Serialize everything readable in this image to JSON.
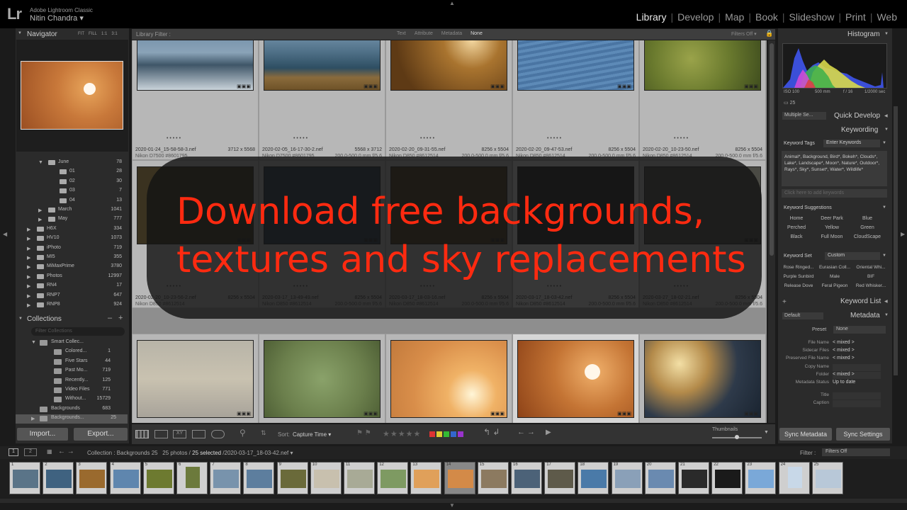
{
  "app": {
    "logo": "Lr",
    "name": "Adobe Lightroom Classic",
    "user": "Nitin Chandra ▾"
  },
  "modules": [
    "Library",
    "Develop",
    "Map",
    "Book",
    "Slideshow",
    "Print",
    "Web"
  ],
  "navigator": {
    "title": "Navigator",
    "zoom": [
      "FIT",
      "FILL",
      "1:1",
      "3:1"
    ]
  },
  "folders": [
    {
      "label": "June",
      "count": "78",
      "indent": 2
    },
    {
      "label": "01",
      "count": "28",
      "indent": 3
    },
    {
      "label": "02",
      "count": "30",
      "indent": 3
    },
    {
      "label": "03",
      "count": "7",
      "indent": 3
    },
    {
      "label": "04",
      "count": "13",
      "indent": 3
    },
    {
      "label": "March",
      "count": "1041",
      "indent": 2
    },
    {
      "label": "May",
      "count": "777",
      "indent": 2
    },
    {
      "label": "H6X",
      "count": "334",
      "indent": 1
    },
    {
      "label": "HV10",
      "count": "1073",
      "indent": 1
    },
    {
      "label": "iPhoto",
      "count": "719",
      "indent": 1
    },
    {
      "label": "MI5",
      "count": "355",
      "indent": 1
    },
    {
      "label": "MiMaxPrime",
      "count": "3780",
      "indent": 1
    },
    {
      "label": "Photos",
      "count": "12997",
      "indent": 1
    },
    {
      "label": "RN4",
      "count": "17",
      "indent": 1
    },
    {
      "label": "RNP7",
      "count": "647",
      "indent": 1
    },
    {
      "label": "RNP8",
      "count": "924",
      "indent": 1
    }
  ],
  "collections": {
    "title": "Collections",
    "filter_placeholder": "Filter Collections",
    "items": [
      {
        "label": "Smart Collec...",
        "count": ""
      },
      {
        "label": "Colored...",
        "count": "1"
      },
      {
        "label": "Five Stars",
        "count": "44"
      },
      {
        "label": "Past Mo...",
        "count": "719"
      },
      {
        "label": "Recently...",
        "count": "125"
      },
      {
        "label": "Video Files",
        "count": "771"
      },
      {
        "label": "Without...",
        "count": "15729"
      },
      {
        "label": "Backgrounds",
        "count": "683"
      },
      {
        "label": "Backgrounds...",
        "count": "25"
      }
    ]
  },
  "left_buttons": {
    "import": "Import...",
    "export": "Export..."
  },
  "library_filter": {
    "label": "Library Filter :",
    "tabs": [
      "Text",
      "Attribute",
      "Metadata",
      "None"
    ],
    "filters_off": "Filters Off ▾"
  },
  "grid": {
    "row1": [
      {
        "file": "2020-01-24_15-58-58-3.nef",
        "dims": "3712 x 5568",
        "cam": "Nikon D7500 #8601795",
        "lens": ""
      },
      {
        "file": "2020-02-05_16-17-30-2.nef",
        "dims": "5568 x 3712",
        "cam": "Nikon D7500 #8601795",
        "lens": "200.0-500.0 mm f/5.6"
      },
      {
        "file": "2020-02-20_09-31-55.nef",
        "dims": "8256 x 5504",
        "cam": "Nikon D850 #8612514",
        "lens": "200.0-500.0 mm f/5.6"
      },
      {
        "file": "2020-02-20_09-47-53.nef",
        "dims": "8256 x 5504",
        "cam": "Nikon D850 #8612514",
        "lens": "200.0-500.0 mm f/5.6"
      },
      {
        "file": "2020-02-20_10-23-50.nef",
        "dims": "8256 x 5504",
        "cam": "Nikon D850 #8612514",
        "lens": "200.0-500.0 mm f/5.6"
      }
    ],
    "row2": [
      {
        "file": "2020-02-20_10-23-56-2.nef",
        "dims": "8256 x 5504",
        "cam": "Nikon D850 #8612514",
        "lens": ""
      },
      {
        "file": "2020-03-17_13-49-49.nef",
        "dims": "8256 x 5504",
        "cam": "Nikon D850 #8612514",
        "lens": "200.0-500.0 mm f/5.6"
      },
      {
        "file": "2020-03-17_18-03-16.nef",
        "dims": "8256 x 5504",
        "cam": "Nikon D850 #8612514",
        "lens": "200.0-500.0 mm f/5.6"
      },
      {
        "file": "2020-03-17_18-03-42.nef",
        "dims": "8256 x 5504",
        "cam": "Nikon D850 #8612514",
        "lens": "200.0-500.0 mm f/5.6"
      },
      {
        "file": "2020-03-27_18-02-21.nef",
        "dims": "8256 x 5504",
        "cam": "Nikon D850 #8612514",
        "lens": "200.0-500.0 mm f/5.6"
      }
    ],
    "dots": "• • • • •"
  },
  "overlay_text": [
    "Download free backgrounds,",
    "textures and sky replacements"
  ],
  "toolbar": {
    "sort_label": "Sort:",
    "sort_value": "Capture Time ▾",
    "thumbnails": "Thumbnails"
  },
  "histogram": {
    "title": "Histogram",
    "iso": "ISO 100",
    "focal": "500 mm",
    "aperture": "f / 16",
    "shutter": "1/2000 sec",
    "count": "25"
  },
  "quick_develop": {
    "preset": "Multiple Se...",
    "title": "Quick Develop"
  },
  "keywording": {
    "title": "Keywording",
    "tags_label": "Keyword Tags",
    "tags_value": "Enter Keywords",
    "keywords": "Animal*, Background, Bird*, Bokeh*, Clouds*, Lake*, Landscape*, Moon*, Nature*, Outdoor*, Rays*, Sky*, Sunset*, Water*, Wildlife*",
    "add_placeholder": "Click here to add keywords",
    "suggestions_label": "Keyword Suggestions",
    "suggestions": [
      "Home",
      "Deer Park",
      "Blue",
      "Perched",
      "Yellow",
      "Green",
      "Black",
      "Full Moon",
      "CloudScape"
    ],
    "set_label": "Keyword Set",
    "set_value": "Custom",
    "set_items": [
      "Rose Ringed...",
      "Eurasian Coll...",
      "Oriental Whi...",
      "Purple Sunbird",
      "Male",
      "BIF",
      "Release Dove",
      "Feral Pigeon",
      "Red Whisker..."
    ]
  },
  "keyword_list": {
    "title": "Keyword List"
  },
  "metadata": {
    "title": "Metadata",
    "default": "Default",
    "preset_label": "Preset",
    "preset_value": "None",
    "fields": [
      {
        "label": "File Name",
        "value": "< mixed >"
      },
      {
        "label": "Sidecar Files",
        "value": "< mixed >"
      },
      {
        "label": "Preserved File Name",
        "value": "< mixed >"
      },
      {
        "label": "Copy Name",
        "value": ""
      },
      {
        "label": "Folder",
        "value": "< mixed >"
      },
      {
        "label": "Metadata Status",
        "value": "Up to date"
      },
      {
        "label": "Title",
        "value": ""
      },
      {
        "label": "Caption",
        "value": ""
      }
    ]
  },
  "right_buttons": {
    "sync_metadata": "Sync Metadata",
    "sync_settings": "Sync Settings"
  },
  "filmstrip": {
    "page1": "1",
    "page2": "2",
    "path": "Collection : Backgrounds 25",
    "count": "25 photos /",
    "selected": "25 selected",
    "file": "/2020-03-17_18-03-42.nef ▾",
    "filter_label": "Filter :",
    "filter_value": "Filters Off"
  },
  "filmstrip_numbers": [
    "1",
    "2",
    "3",
    "4",
    "5",
    "6",
    "7",
    "8",
    "9",
    "10",
    "11",
    "12",
    "13",
    "14",
    "15",
    "16",
    "17",
    "18",
    "19",
    "20",
    "21",
    "22",
    "23",
    "24",
    "25"
  ]
}
